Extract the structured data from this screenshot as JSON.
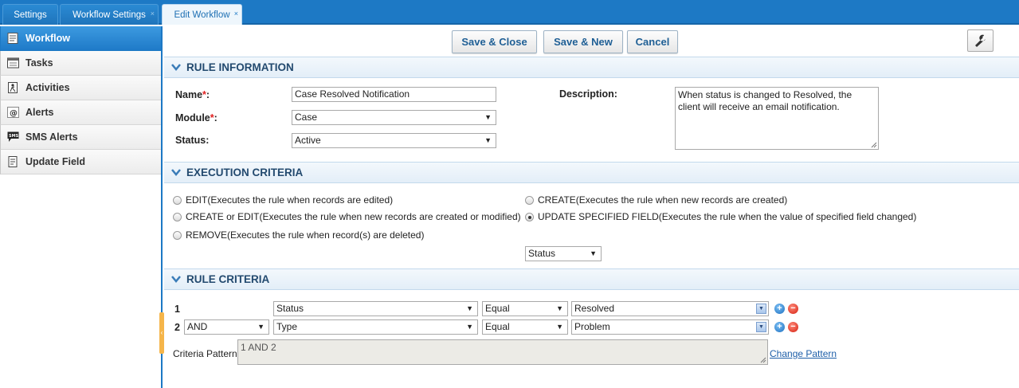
{
  "tabs": [
    {
      "label": "Settings"
    },
    {
      "label": "Workflow Settings",
      "close": "×"
    },
    {
      "label": "Edit Workflow",
      "close": "×"
    }
  ],
  "sidebar": {
    "items": [
      {
        "label": "Workflow",
        "icon": "document-icon"
      },
      {
        "label": "Tasks",
        "icon": "calendar-icon"
      },
      {
        "label": "Activities",
        "icon": "activity-icon"
      },
      {
        "label": "Alerts",
        "icon": "at-sign-icon"
      },
      {
        "label": "SMS Alerts",
        "icon": "sms-icon"
      },
      {
        "label": "Update Field",
        "icon": "field-icon"
      }
    ]
  },
  "toolbar": {
    "save_close": "Save & Close",
    "save_new": "Save & New",
    "cancel": "Cancel"
  },
  "rule_info": {
    "title": "RULE INFORMATION",
    "name_label": "Name",
    "name_value": "Case Resolved Notification",
    "module_label": "Module",
    "module_value": "Case",
    "status_label": "Status:",
    "status_value": "Active",
    "description_label": "Description:",
    "description_value": "When status is changed to Resolved, the client will receive an email notification."
  },
  "execution": {
    "title": "EXECUTION CRITERIA",
    "options": [
      {
        "label": "EDIT(Executes the rule when records are edited)",
        "checked": false
      },
      {
        "label": "CREATE(Executes the rule when new records are created)",
        "checked": false
      },
      {
        "label": "CREATE or EDIT(Executes the rule when new records are created or modified)",
        "checked": false
      },
      {
        "label": "UPDATE SPECIFIED FIELD(Executes the rule when the value of specified field changed)",
        "checked": true
      },
      {
        "label": "REMOVE(Executes the rule when record(s) are deleted)",
        "checked": false
      }
    ],
    "field_value": "Status"
  },
  "rule_criteria": {
    "title": "RULE CRITERIA",
    "rows": [
      {
        "num": "1",
        "field": "Status",
        "operator": "Equal",
        "value": "Resolved"
      },
      {
        "num": "2",
        "join": "AND",
        "field": "Type",
        "operator": "Equal",
        "value": "Problem"
      }
    ],
    "pattern_label": "Criteria Pattern",
    "pattern_value": "1 AND 2",
    "change_pattern": "Change Pattern"
  },
  "colors": {
    "accent": "#1d79c5",
    "required": "#e02020",
    "button_text": "#1f5f95"
  }
}
